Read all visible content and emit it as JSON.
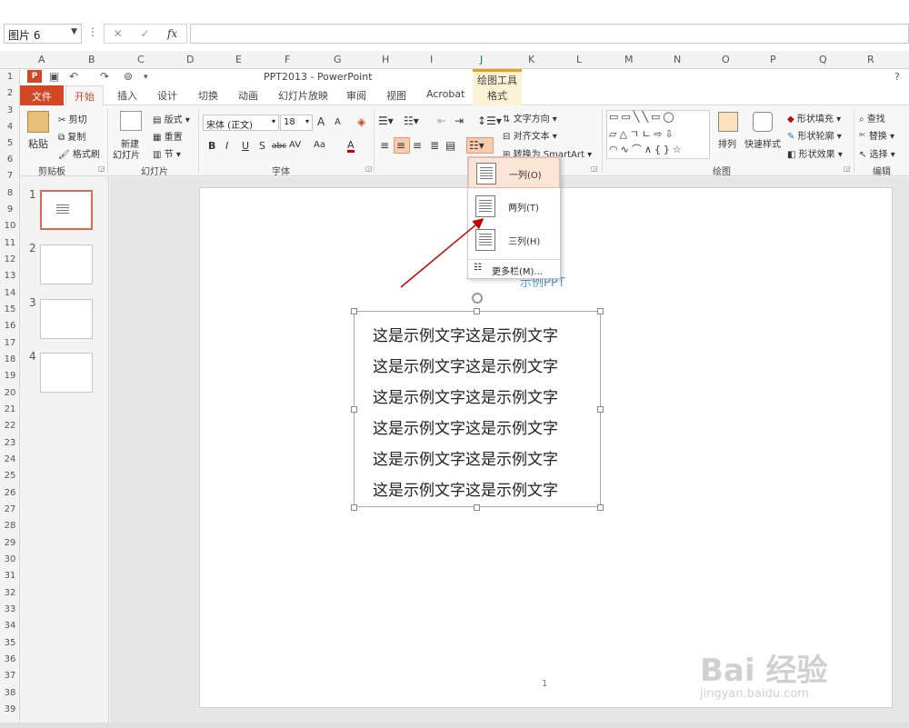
{
  "excel": {
    "namebox": "图片 6",
    "columns": [
      "A",
      "B",
      "C",
      "D",
      "E",
      "F",
      "G",
      "H",
      "I",
      "J",
      "K",
      "L",
      "M",
      "N",
      "O",
      "P",
      "Q",
      "R"
    ],
    "rows": [
      "1",
      "2",
      "3",
      "4",
      "5",
      "6",
      "7",
      "8",
      "9",
      "10",
      "11",
      "12",
      "13",
      "14",
      "15",
      "16",
      "17",
      "18",
      "19",
      "20",
      "21",
      "22",
      "23",
      "24",
      "25",
      "26",
      "27",
      "28",
      "29",
      "30",
      "31",
      "32",
      "33",
      "34",
      "35",
      "36",
      "37",
      "38",
      "39"
    ]
  },
  "ppt": {
    "title": "PPT2013 - PowerPoint",
    "tool_tab_title": "绘图工具",
    "help": "?",
    "tabs": [
      "文件",
      "开始",
      "插入",
      "设计",
      "切换",
      "动画",
      "幻灯片放映",
      "审阅",
      "视图",
      "Acrobat",
      "格式"
    ],
    "ribbon": {
      "clipboard": {
        "paste": "粘贴",
        "cut": "剪切",
        "copy": "复制",
        "format_painter": "格式刷",
        "label": "剪贴板"
      },
      "slides": {
        "new_slide_1": "新建",
        "new_slide_2": "幻灯片",
        "layout": "版式",
        "reset": "重置",
        "section": "节",
        "label": "幻灯片"
      },
      "font": {
        "name": "宋体 (正文)",
        "size": "18",
        "bold": "B",
        "italic": "I",
        "underline": "U",
        "shadow": "S",
        "strike": "abc",
        "spacing": "AV",
        "case": "Aa",
        "color": "A",
        "grow": "A",
        "shrink": "A",
        "label": "字体"
      },
      "paragraph": {
        "text_direction": "文字方向",
        "align_text": "对齐文本",
        "smartart": "转换为 SmartArt"
      },
      "drawing": {
        "arrange": "排列",
        "quick_styles": "快速样式",
        "shape_fill": "形状填充",
        "shape_outline": "形状轮廓",
        "shape_effects": "形状效果",
        "label": "绘图"
      },
      "editing": {
        "find": "查找",
        "replace": "替换",
        "select": "选择",
        "label": "编辑"
      }
    },
    "column_menu": {
      "one": "一列(O)",
      "two": "两列(T)",
      "three": "三列(H)",
      "more": "更多栏(M)..."
    },
    "slides": [
      "1",
      "2",
      "3",
      "4"
    ],
    "slide": {
      "title": "示例PPT",
      "lines": [
        "这是示例文字这是示例文字",
        "这是示例文字这是示例文字",
        "这是示例文字这是示例文字",
        "这是示例文字这是示例文字",
        "这是示例文字这是示例文字",
        "这是示例文字这是示例文字"
      ],
      "page_number": "1"
    }
  },
  "watermark": {
    "brand": "Bai 经验",
    "url": "jingyan.baidu.com"
  },
  "colors": {
    "accent": "#d24726",
    "tool_tab": "#fdf2d6",
    "menu_highlight": "#fce4d6",
    "arrow": "#c00000",
    "title_blue": "#5b9bd5"
  }
}
